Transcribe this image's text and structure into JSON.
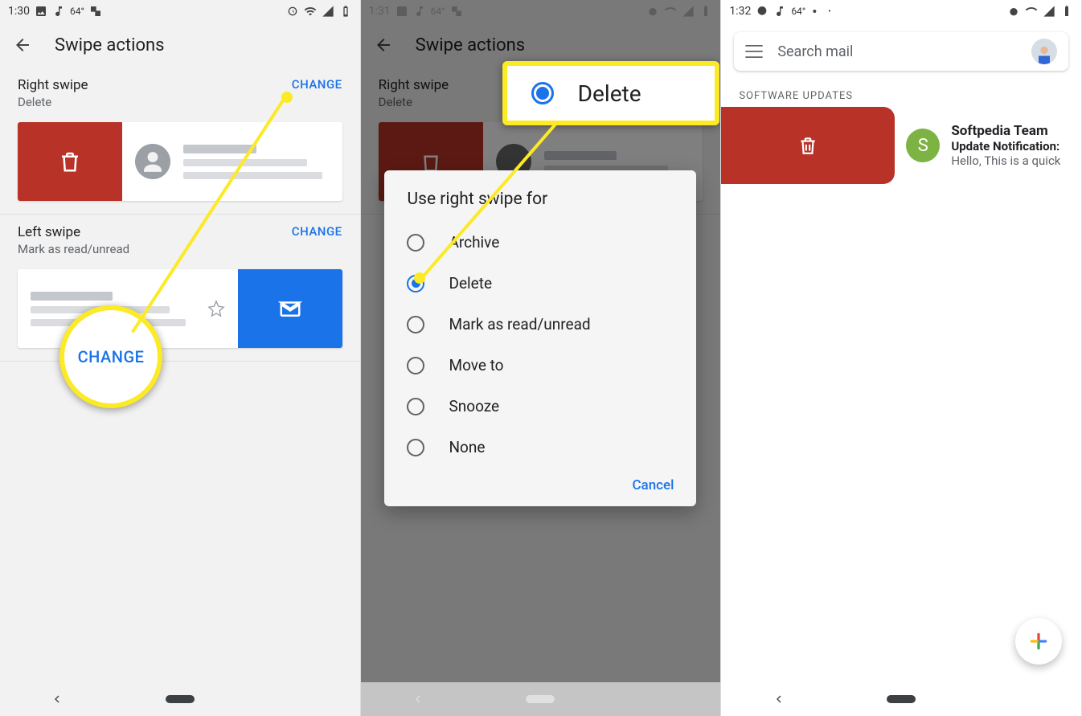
{
  "screen1": {
    "time": "1:30",
    "app_title": "Swipe actions",
    "right_swipe": {
      "title": "Right swipe",
      "value": "Delete",
      "change": "CHANGE"
    },
    "left_swipe": {
      "title": "Left swipe",
      "value": "Mark as read/unread",
      "change": "CHANGE"
    },
    "highlight_label": "CHANGE"
  },
  "screen2": {
    "time": "1:31",
    "app_title": "Swipe actions",
    "right_swipe": {
      "title": "Right swipe",
      "value": "Delete"
    },
    "dialog": {
      "title": "Use right swipe for",
      "options": [
        "Archive",
        "Delete",
        "Mark as read/unread",
        "Move to",
        "Snooze",
        "None"
      ],
      "selected_index": 1,
      "cancel": "Cancel"
    },
    "highlight_label": "Delete"
  },
  "screen3": {
    "time": "1:32",
    "search_placeholder": "Search mail",
    "section_label": "SOFTWARE UPDATES",
    "email": {
      "avatar_initial": "S",
      "sender": "Softpedia Team",
      "subject": "Update Notification:",
      "snippet": "Hello, This is a quick"
    }
  }
}
